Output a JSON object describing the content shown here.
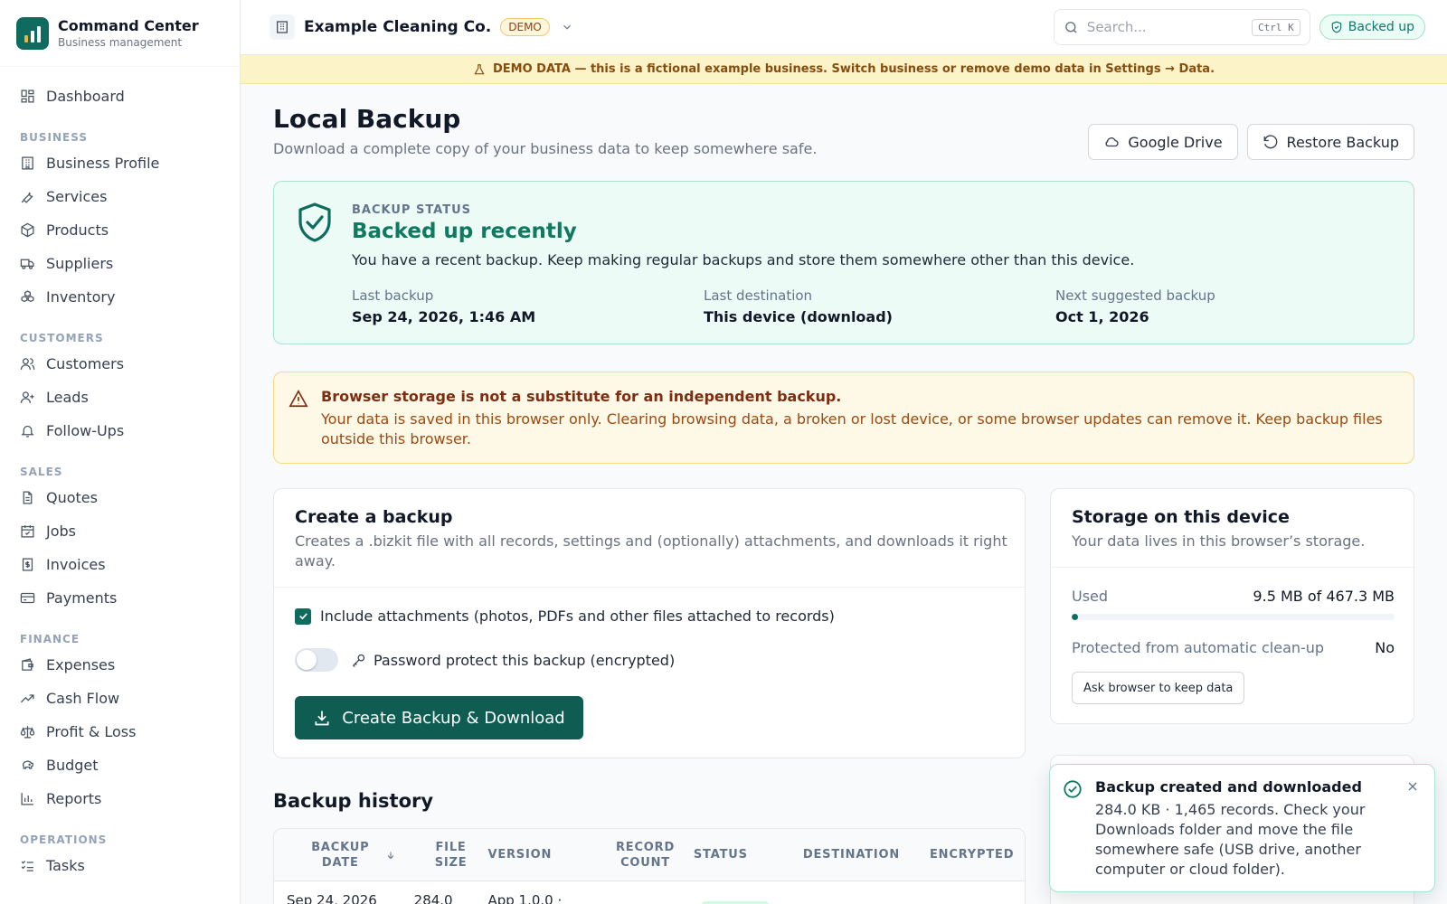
{
  "brand": {
    "title": "Command Center",
    "subtitle": "Business management"
  },
  "nav": {
    "dashboard": "Dashboard",
    "sections": [
      {
        "label": "BUSINESS",
        "items": [
          "Business Profile",
          "Services",
          "Products",
          "Suppliers",
          "Inventory"
        ]
      },
      {
        "label": "CUSTOMERS",
        "items": [
          "Customers",
          "Leads",
          "Follow-Ups"
        ]
      },
      {
        "label": "SALES",
        "items": [
          "Quotes",
          "Jobs",
          "Invoices",
          "Payments"
        ]
      },
      {
        "label": "FINANCE",
        "items": [
          "Expenses",
          "Cash Flow",
          "Profit & Loss",
          "Budget",
          "Reports"
        ]
      },
      {
        "label": "OPERATIONS",
        "items": [
          "Tasks"
        ]
      }
    ]
  },
  "topbar": {
    "business_name": "Example Cleaning Co.",
    "demo_badge": "DEMO",
    "search_placeholder": "Search...",
    "search_shortcut": "Ctrl K",
    "backup_badge": "Backed up"
  },
  "demo_banner": "DEMO DATA — this is a fictional example business. Switch business or remove demo data in Settings → Data.",
  "page": {
    "title": "Local Backup",
    "subtitle": "Download a complete copy of your business data to keep somewhere safe.",
    "google_drive_label": "Google Drive",
    "restore_label": "Restore Backup"
  },
  "status": {
    "label": "BACKUP STATUS",
    "title": "Backed up recently",
    "description": "You have a recent backup. Keep making regular backups and store them somewhere other than this device.",
    "last_backup_label": "Last backup",
    "last_backup_value": "Sep 24, 2026, 1:46 AM",
    "last_destination_label": "Last destination",
    "last_destination_value": "This device (download)",
    "next_label": "Next suggested backup",
    "next_value": "Oct 1, 2026"
  },
  "warning": {
    "title": "Browser storage is not a substitute for an independent backup.",
    "text": "Your data is saved in this browser only. Clearing browsing data, a broken or lost device, or some browser updates can remove it. Keep backup files outside this browser."
  },
  "create": {
    "title": "Create a backup",
    "subtitle": "Creates a .bizkit file with all records, settings and (optionally) attachments, and downloads it right away.",
    "include_attachments_label": "Include attachments (photos, PDFs and other files attached to records)",
    "include_attachments_checked": true,
    "password_label": "Password protect this backup (encrypted)",
    "password_enabled": false,
    "button_label": "Create Backup & Download"
  },
  "storage": {
    "title": "Storage on this device",
    "subtitle": "Your data lives in this browser’s storage.",
    "used_label": "Used",
    "used_value": "9.5 MB of 467.3 MB",
    "used_fraction": 0.0203,
    "protected_label": "Protected from automatic clean-up",
    "protected_value": "No",
    "button_label": "Ask browser to keep data"
  },
  "history": {
    "title": "Backup history",
    "columns": [
      "BACKUP DATE",
      "FILE SIZE",
      "VERSION",
      "RECORD COUNT",
      "STATUS",
      "DESTINATION",
      "ENCRYPTED"
    ],
    "rows": [
      {
        "date": "Sep 24, 2026",
        "size": "284.0",
        "version": "App 1.0.0 ·"
      }
    ]
  },
  "toast": {
    "title": "Backup created and downloaded",
    "message": "284.0 KB · 1,465 records. Check your Downloads folder and move the file somewhere safe (USB drive, another computer or cloud folder)."
  },
  "colors": {
    "accent": "#0f6b5e",
    "success": "#0f7a5f",
    "warning": "#7c2d12",
    "demo": "#854d0e"
  }
}
